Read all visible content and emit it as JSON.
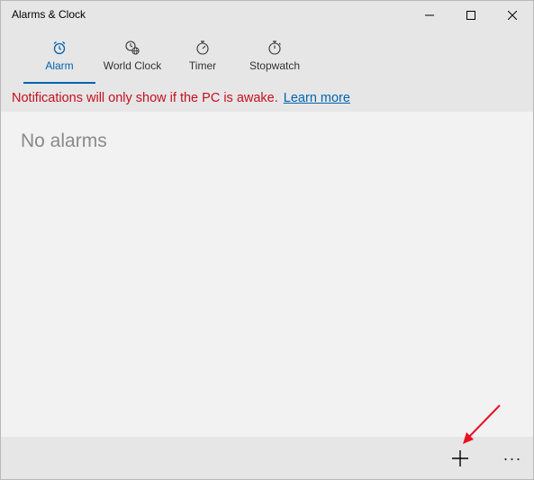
{
  "window": {
    "title": "Alarms & Clock"
  },
  "tabs": [
    {
      "label": "Alarm",
      "icon": "alarm-clock-icon",
      "active": true
    },
    {
      "label": "World Clock",
      "icon": "world-clock-icon",
      "active": false
    },
    {
      "label": "Timer",
      "icon": "timer-icon",
      "active": false
    },
    {
      "label": "Stopwatch",
      "icon": "stopwatch-icon",
      "active": false
    }
  ],
  "notice": {
    "text": "Notifications will only show if the PC is awake.",
    "link_text": "Learn more"
  },
  "main": {
    "empty_message": "No alarms"
  },
  "bottombar": {
    "more_label": "···"
  },
  "colors": {
    "accent": "#0063b1",
    "warning_text": "#c50f1f",
    "header_bg": "#e6e6e6",
    "content_bg": "#f2f2f2",
    "annotation_arrow": "#e81123"
  }
}
